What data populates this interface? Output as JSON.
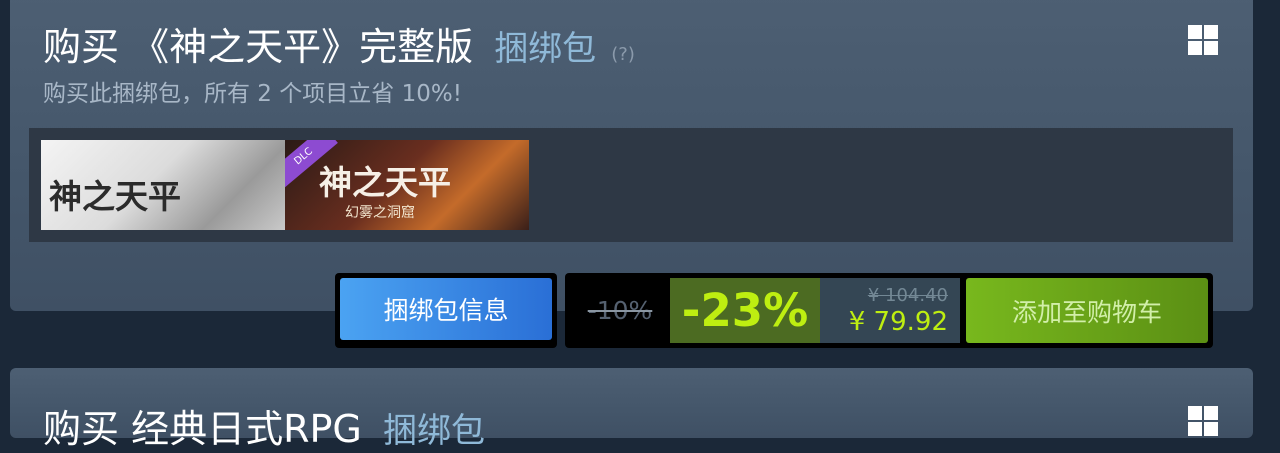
{
  "bundle1": {
    "title": "购买 《神之天平》完整版",
    "tag": "捆绑包",
    "help": "(?)",
    "subtitle": "购买此捆绑包，所有 2 个项目立省 10%!",
    "items": [
      {
        "logo": "神之天平",
        "sub": ""
      },
      {
        "logo": "神之天平",
        "sub": "幻雾之洞窟",
        "badge": "DLC"
      }
    ],
    "info_button": "捆绑包信息",
    "bundle_discount": "-10%",
    "discount": "-23%",
    "original_price": "¥ 104.40",
    "final_price": "¥ 79.92",
    "cart_button": "添加至购物车"
  },
  "bundle2": {
    "title": "购买 经典日式RPG",
    "tag": "捆绑包"
  },
  "colors": {
    "background": "#1b2838",
    "panel": "#4d5f73",
    "accent_blue": "#2a6fd6",
    "discount_green": "#beee11",
    "cart_green": "#78b81d",
    "tag_blue": "#8fb9d8"
  },
  "icons": {
    "platform": "windows-icon"
  }
}
